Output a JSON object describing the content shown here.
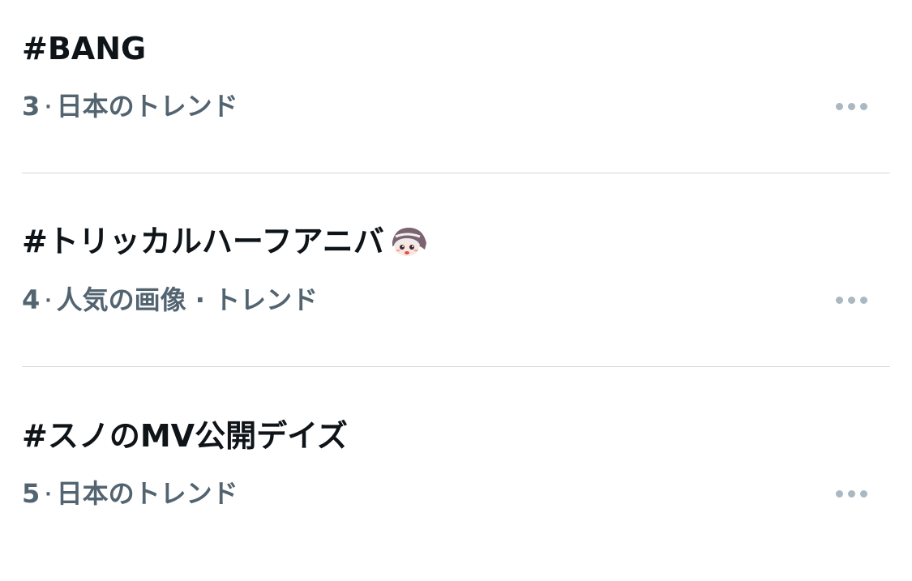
{
  "trends": [
    {
      "title": "#BANG",
      "rank": "3",
      "context": "日本のトレンド",
      "more_icon": "more-horizontal-icon"
    },
    {
      "title": "#トリッカルハーフアニバ",
      "rank": "4",
      "context": "人気の画像 · トレンド",
      "more_icon": "more-horizontal-icon",
      "hashflag": "character-sticker-icon"
    },
    {
      "title": "#スノのMV公開デイズ",
      "rank": "5",
      "context": "日本のトレンド",
      "more_icon": "more-horizontal-icon"
    }
  ],
  "colors": {
    "title": "#0f1419",
    "meta": "#536471",
    "dots": "#aab8c2",
    "divider": "#cfd9de"
  }
}
